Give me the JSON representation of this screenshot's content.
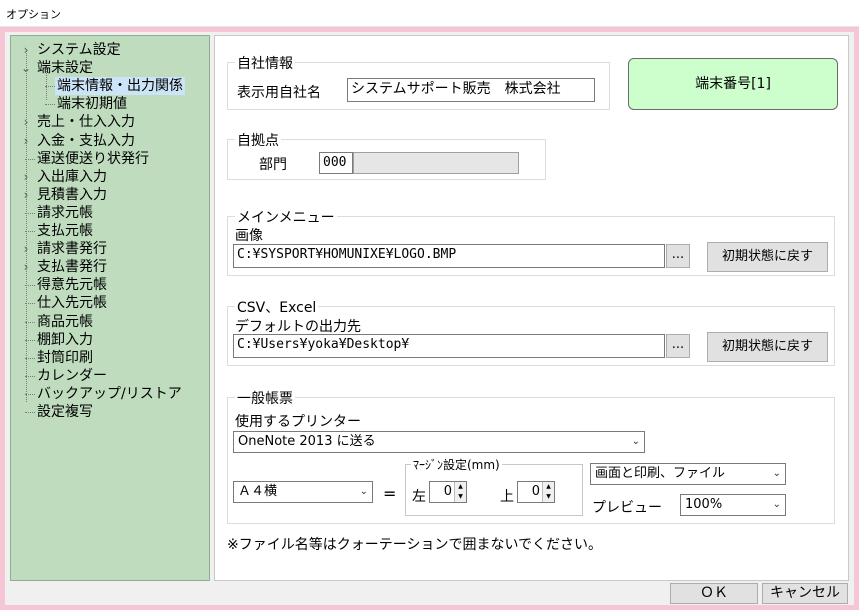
{
  "window": {
    "title": "オプション"
  },
  "tree": {
    "items": [
      {
        "label": "システム設定",
        "arrow": "›"
      },
      {
        "label": "端末設定",
        "arrow": "⌄"
      },
      {
        "label": "端末情報・出力関係",
        "arrow": ""
      },
      {
        "label": "端末初期値",
        "arrow": ""
      },
      {
        "label": "売上・仕入入力",
        "arrow": "›"
      },
      {
        "label": "入金・支払入力",
        "arrow": "›"
      },
      {
        "label": "運送便送り状発行",
        "arrow": ""
      },
      {
        "label": "入出庫入力",
        "arrow": "›"
      },
      {
        "label": "見積書入力",
        "arrow": "›"
      },
      {
        "label": "請求元帳",
        "arrow": ""
      },
      {
        "label": "支払元帳",
        "arrow": ""
      },
      {
        "label": "請求書発行",
        "arrow": "›"
      },
      {
        "label": "支払書発行",
        "arrow": "›"
      },
      {
        "label": "得意先元帳",
        "arrow": ""
      },
      {
        "label": "仕入先元帳",
        "arrow": ""
      },
      {
        "label": "商品元帳",
        "arrow": ""
      },
      {
        "label": "棚卸入力",
        "arrow": ""
      },
      {
        "label": "封筒印刷",
        "arrow": ""
      },
      {
        "label": "カレンダー",
        "arrow": ""
      },
      {
        "label": "バックアップ/リストア",
        "arrow": ""
      },
      {
        "label": "設定複写",
        "arrow": ""
      }
    ]
  },
  "company": {
    "group_title": "自社情報",
    "name_label": "表示用自社名",
    "name_value": "システムサポート販売　株式会社"
  },
  "terminal_label": "端末番号[1]",
  "base": {
    "group_title": "自拠点",
    "dept_label": "部門",
    "dept_value": "000"
  },
  "main_menu": {
    "group_title": "メインメニュー",
    "image_label": "画像",
    "image_path": "C:¥SYSPORT¥HOMUNIXE¥LOGO.BMP",
    "browse_label": "...",
    "reset_label": "初期状態に戻す"
  },
  "csv": {
    "group_title": "CSV、Excel",
    "output_label": "デフォルトの出力先",
    "output_path": "C:¥Users¥yoka¥Desktop¥",
    "browse_label": "...",
    "reset_label": "初期状態に戻す"
  },
  "forms": {
    "group_title": "一般帳票",
    "printer_label": "使用するプリンター",
    "printer_value": "OneNote 2013 に送る",
    "paper_value": "Ａ４横",
    "equals": "=",
    "margin_title": "ﾏｰｼﾞﾝ設定(mm)",
    "left_label": "左",
    "left_value": "0",
    "top_label": "上",
    "top_value": "0",
    "output_value": "画面と印刷、ファイル",
    "preview_label": "プレビュー",
    "preview_value": "100%"
  },
  "note": "※ファイル名等はクォーテーションで囲まないでください。",
  "buttons": {
    "ok": "ＯＫ",
    "cancel": "キャンセル"
  }
}
